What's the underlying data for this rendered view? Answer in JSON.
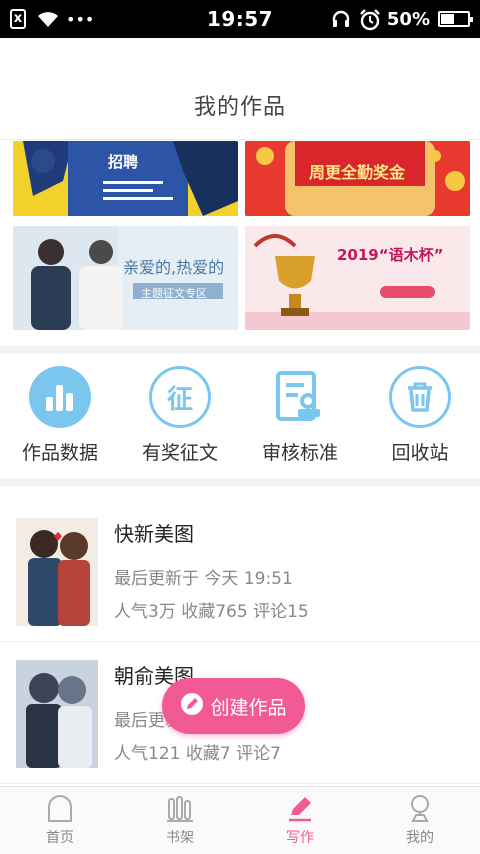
{
  "status_bar": {
    "time": "19:57",
    "battery": "50%",
    "battery_level": 0.5,
    "dots": "•••",
    "sim_icon_text": "x"
  },
  "header": {
    "title": "我的作品"
  },
  "banners": [
    {
      "name": "recruit-banner",
      "text": "招聘"
    },
    {
      "name": "bonus-banner",
      "text": "周更全勤奖金"
    },
    {
      "name": "contest-banner",
      "text": "亲爱的,热爱的",
      "sub": "主题征文专区"
    },
    {
      "name": "cup-banner",
      "text": "2019“语木杯”"
    }
  ],
  "tools": [
    {
      "name": "works-data",
      "label": "作品数据",
      "icon": "bar-chart-icon"
    },
    {
      "name": "prize-essay",
      "label": "有奖征文",
      "icon": "zheng-badge-icon",
      "icon_text": "征"
    },
    {
      "name": "review-standard",
      "label": "审核标准",
      "icon": "document-stamp-icon"
    },
    {
      "name": "recycle-bin",
      "label": "回收站",
      "icon": "trash-icon"
    }
  ],
  "works": [
    {
      "title": "快新美图",
      "updated": "最后更新于 今天 19:51",
      "stats": "人气3万 收藏765 评论15"
    },
    {
      "title": "朝俞美图",
      "updated": "最后更新于",
      "stats": "人气121 收藏7 评论7"
    }
  ],
  "create_button": {
    "label": "创建作品"
  },
  "nav": [
    {
      "name": "home",
      "label": "首页",
      "icon": "home-arch-icon"
    },
    {
      "name": "bookshelf",
      "label": "书架",
      "icon": "bookshelf-icon"
    },
    {
      "name": "write",
      "label": "写作",
      "icon": "pen-icon",
      "active": true
    },
    {
      "name": "mine",
      "label": "我的",
      "icon": "person-icon"
    }
  ],
  "colors": {
    "accent": "#f15a94",
    "tool_blue": "#7bc6ef"
  }
}
